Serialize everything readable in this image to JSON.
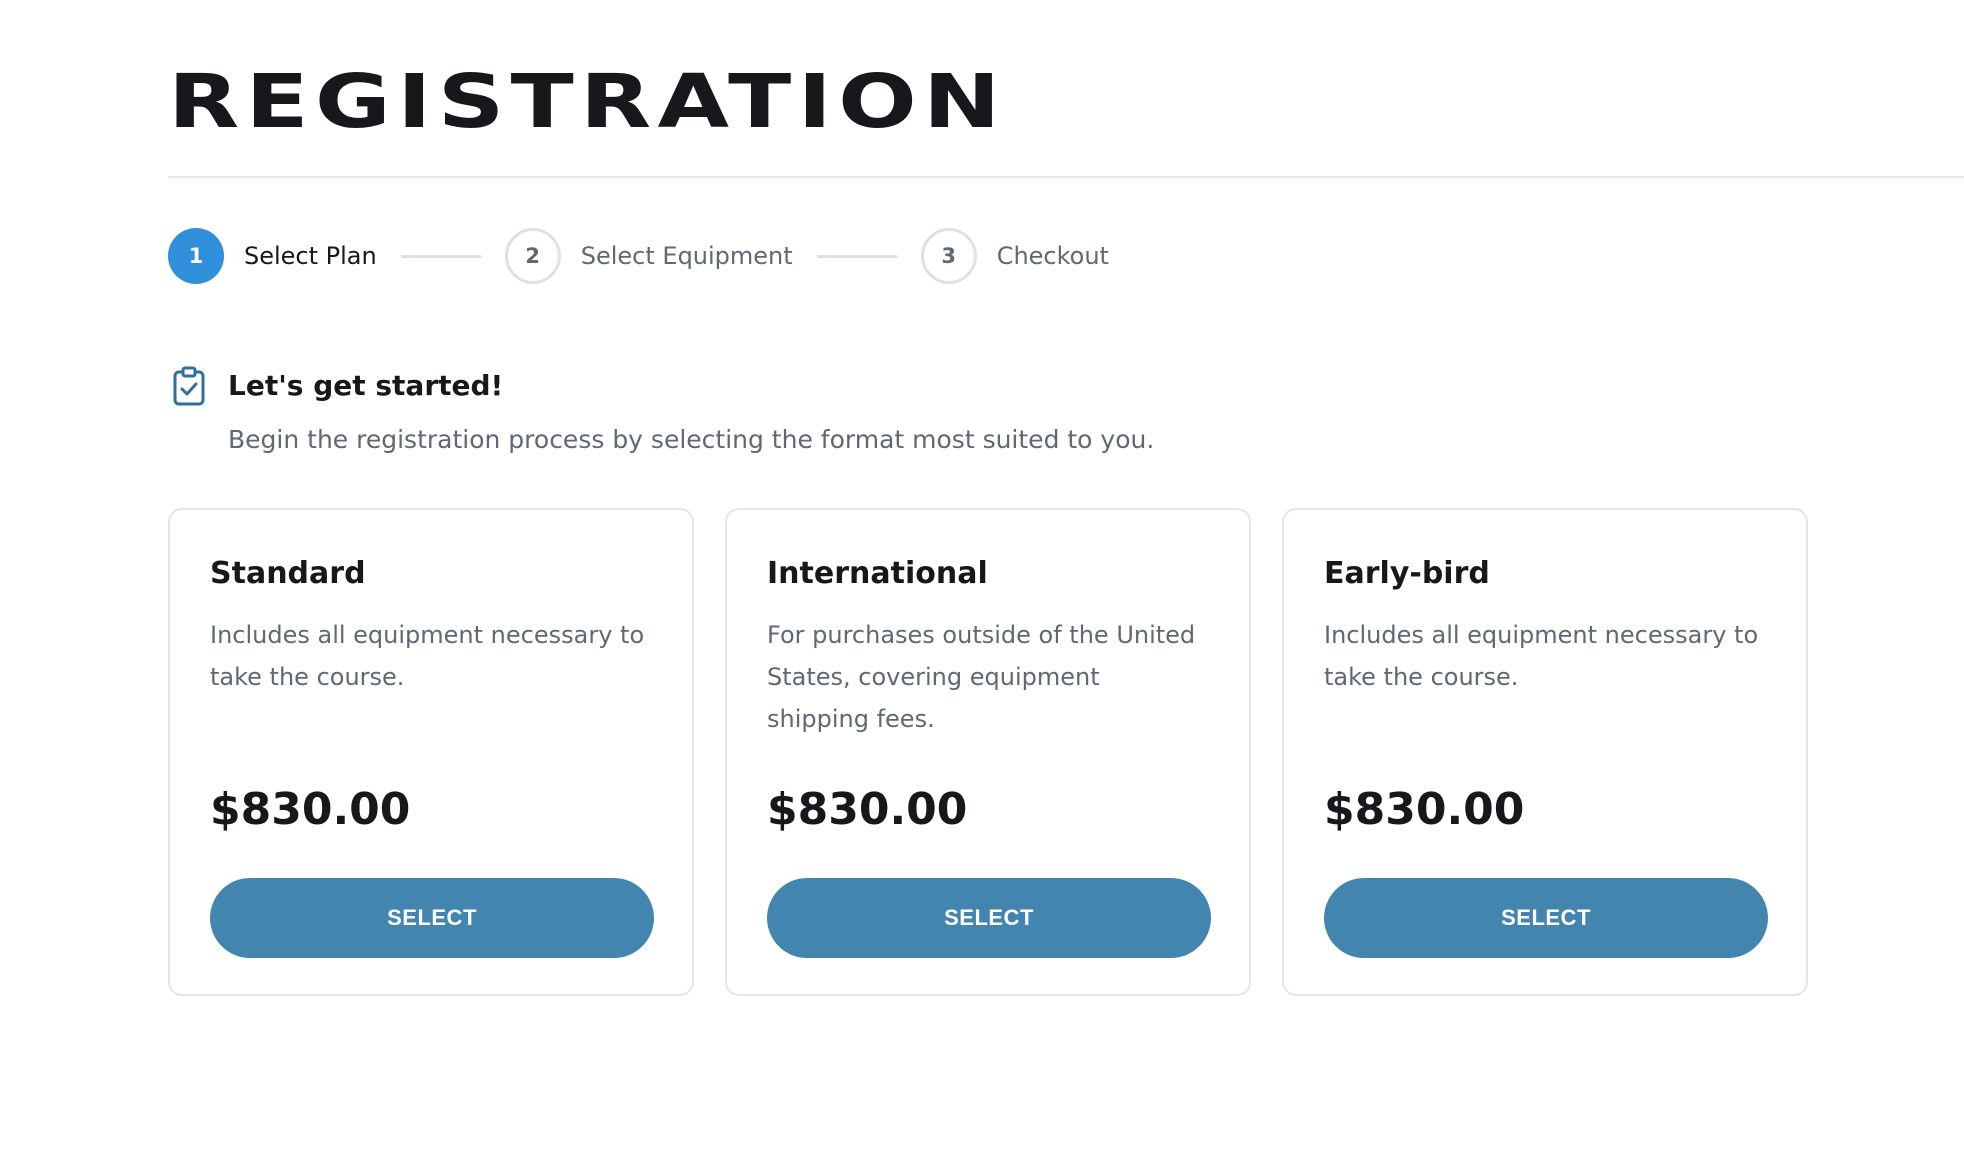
{
  "page": {
    "title": "REGISTRATION"
  },
  "stepper": {
    "steps": [
      {
        "number": "1",
        "label": "Select Plan",
        "state": "active"
      },
      {
        "number": "2",
        "label": "Select Equipment",
        "state": "inactive"
      },
      {
        "number": "3",
        "label": "Checkout",
        "state": "inactive"
      }
    ]
  },
  "intro": {
    "icon": "clipboard-check-icon",
    "heading": "Let's get started!",
    "text": "Begin the registration process by selecting the format most suited to you."
  },
  "plans": [
    {
      "name": "Standard",
      "description": "Includes all equipment necessary to take the course.",
      "price": "$830.00",
      "button_label": "SELECT"
    },
    {
      "name": "International",
      "description": "For purchases outside of the United States, covering equipment shipping fees.",
      "price": "$830.00",
      "button_label": "SELECT"
    },
    {
      "name": "Early-bird",
      "description": "Includes all equipment necessary to take the course.",
      "price": "$830.00",
      "button_label": "SELECT"
    }
  ],
  "colors": {
    "active_step": "#2f8fdb",
    "button": "#4286b0",
    "icon": "#2f6fa0",
    "text_primary": "#16181c",
    "text_muted": "#5f6873",
    "border": "#e3e6ea"
  }
}
